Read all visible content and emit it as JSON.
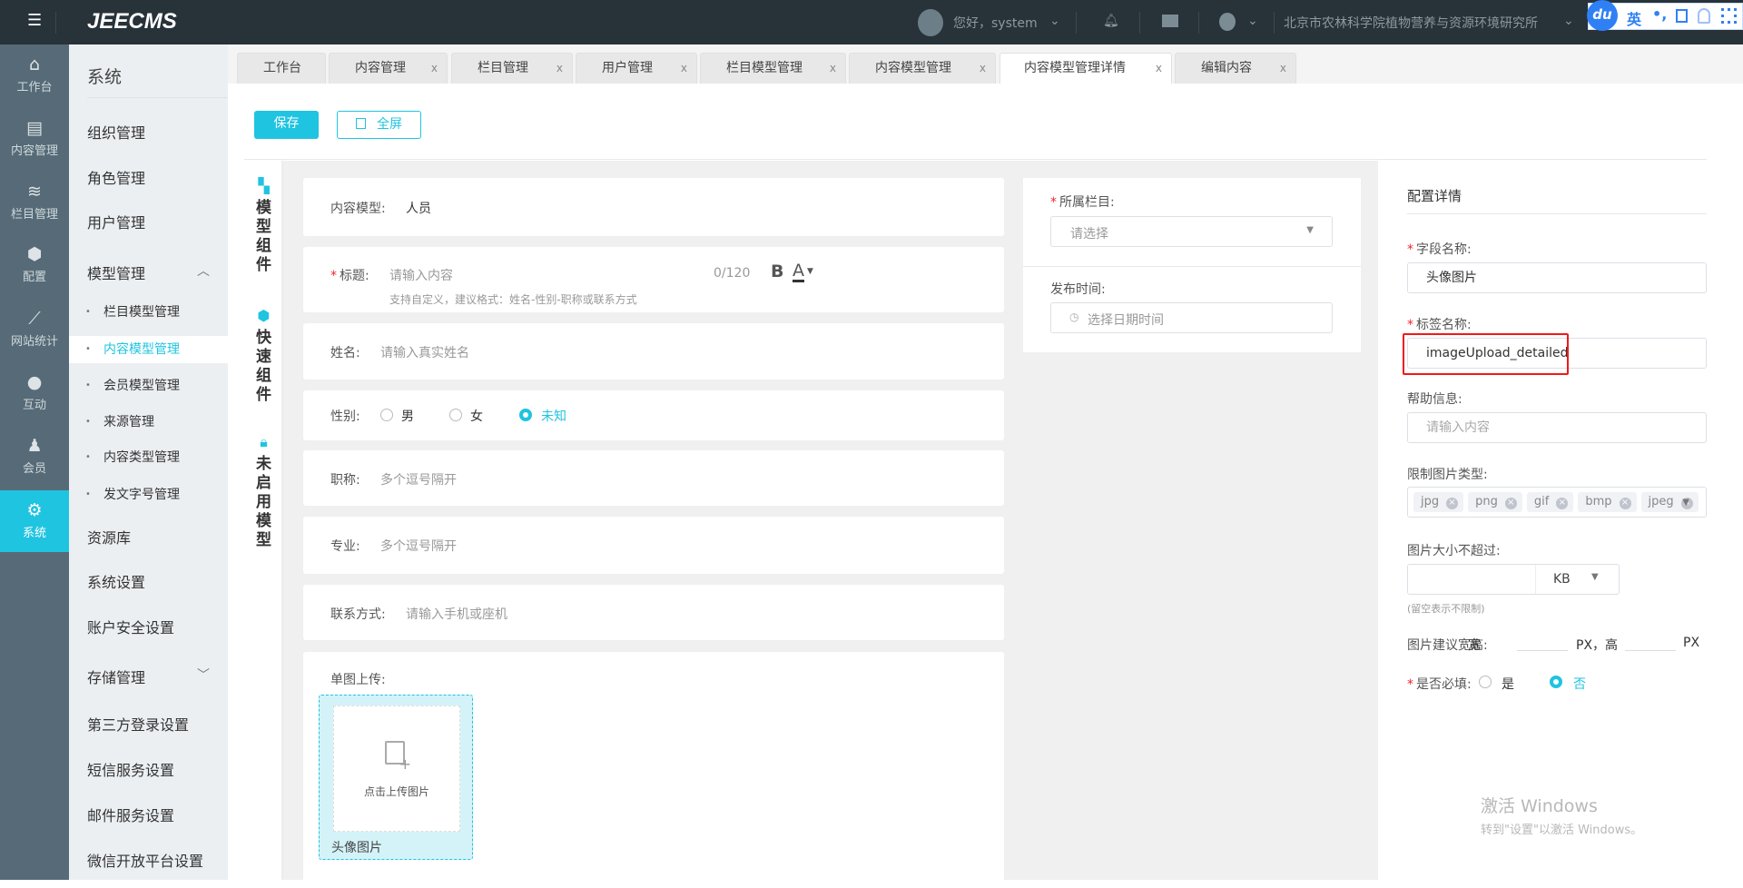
{
  "header": {
    "logo": "JEECMS",
    "greeting": "您好，system",
    "org": "北京市农林科学院植物营养与资源环境研究所",
    "ime": {
      "logo": "du",
      "lang": "英",
      "punct": "•,"
    }
  },
  "iconbar": [
    {
      "label": "工作台",
      "icon": "home-icon"
    },
    {
      "label": "内容管理",
      "icon": "document-icon"
    },
    {
      "label": "栏目管理",
      "icon": "layers-icon"
    },
    {
      "label": "配置",
      "icon": "cube-icon"
    },
    {
      "label": "网站统计",
      "icon": "chart-icon"
    },
    {
      "label": "互动",
      "icon": "chat-icon"
    },
    {
      "label": "会员",
      "icon": "member-icon"
    },
    {
      "label": "系统",
      "icon": "gear-icon"
    }
  ],
  "menu": {
    "title": "系统",
    "items": [
      "组织管理",
      "角色管理",
      "用户管理",
      "模型管理"
    ],
    "sub": [
      "栏目模型管理",
      "内容模型管理",
      "会员模型管理",
      "来源管理",
      "内容类型管理",
      "发文字号管理"
    ],
    "items2": [
      "资源库",
      "系统设置",
      "账户安全设置",
      "存储管理",
      "第三方登录设置",
      "短信服务设置",
      "邮件服务设置",
      "微信开放平台设置"
    ]
  },
  "tabs": [
    "工作台",
    "内容管理",
    "栏目管理",
    "用户管理",
    "栏目模型管理",
    "内容模型管理",
    "内容模型管理详情",
    "编辑内容"
  ],
  "toolbar": {
    "save": "保存",
    "fullscreen": "全屏"
  },
  "leftnav": [
    "模型组件",
    "快速组件",
    "未启用模型"
  ],
  "form": {
    "model_label": "内容模型:",
    "model_value": "人员",
    "title_label": "标题:",
    "title_ph": "请输入内容",
    "title_count": "0/120",
    "title_hint": "支持自定义，建议格式：姓名-性别-职称或联系方式",
    "bold": "B",
    "color": "A",
    "name_label": "姓名:",
    "name_ph": "请输入真实姓名",
    "gender_label": "性别:",
    "genders": [
      "男",
      "女",
      "未知"
    ],
    "job_label": "职称:",
    "job_ph": "多个逗号隔开",
    "major_label": "专业:",
    "major_ph": "多个逗号隔开",
    "contact_label": "联系方式:",
    "contact_ph": "请输入手机或座机",
    "upload_label": "单图上传:",
    "upload_text": "点击上传图片",
    "upload_caption": "头像图片"
  },
  "side": {
    "column_label": "所属栏目:",
    "column_ph": "请选择",
    "time_label": "发布时间:",
    "time_ph": "选择日期时间"
  },
  "config": {
    "title": "配置详情",
    "field_label": "字段名称:",
    "field_value": "头像图片",
    "tag_label": "标签名称:",
    "tag_value": "imageUpload_detailed",
    "help_label": "帮助信息:",
    "help_ph": "请输入内容",
    "types_label": "限制图片类型:",
    "types": [
      "jpg",
      "png",
      "gif",
      "bmp",
      "jpeg"
    ],
    "size_label": "图片大小不超过:",
    "size_unit": "KB",
    "size_hint": "(留空表示不限制)",
    "dim_label": "图片建议宽高:",
    "dim_w": "宽",
    "dim_px1": "PX，高",
    "dim_px2": "PX",
    "required_label": "是否必填:",
    "req_yes": "是",
    "req_no": "否"
  },
  "watermark": {
    "line1": "激活 Windows",
    "line2": "转到\"设置\"以激活 Windows。"
  },
  "colors": {
    "accent": "#1fc4e0",
    "header": "#273239",
    "iconbar": "#566b77"
  }
}
